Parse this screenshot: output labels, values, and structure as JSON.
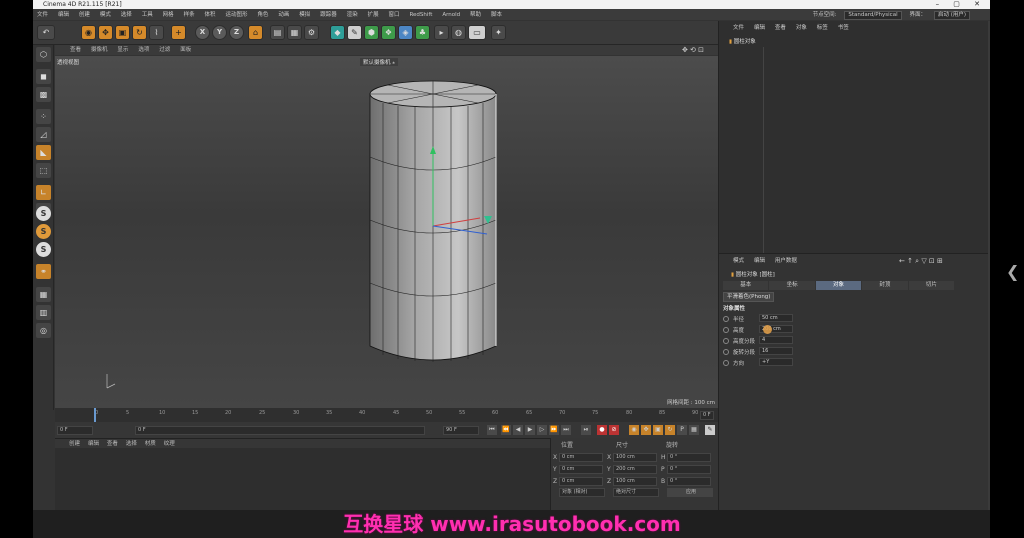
{
  "window": {
    "title": "Cinema 4D R21.115 [R21]",
    "controls": "– ▢ ✕"
  },
  "menu": {
    "items": [
      "文件",
      "编辑",
      "创建",
      "模式",
      "选择",
      "工具",
      "网格",
      "样条",
      "体积",
      "运动图形",
      "角色",
      "动画",
      "模拟",
      "跟踪器",
      "渲染",
      "扩展",
      "窗口",
      "RedShift",
      "Arnold",
      "帮助",
      "脚本"
    ],
    "right": {
      "interface_label": "界面：",
      "interface_value": "启动 (用户)",
      "layout_label": "节点空间:",
      "layout_value": "Standard/Physical"
    }
  },
  "toolbar": {
    "undo": "↶",
    "axes": [
      "X",
      "Y",
      "Z"
    ]
  },
  "viewport": {
    "menu": [
      "查看",
      "摄像机",
      "显示",
      "选项",
      "过滤",
      "面板"
    ],
    "label": "透视视图",
    "camera": "默认摄像机 ⁎",
    "grid": "网格间距 : 100 cm"
  },
  "timeline": {
    "ticks": [
      "0",
      "5",
      "10",
      "15",
      "20",
      "25",
      "30",
      "35",
      "40",
      "45",
      "50",
      "55",
      "60",
      "65",
      "70",
      "75",
      "80",
      "85",
      "90"
    ],
    "end": "0 F",
    "start_field": "0 F",
    "range_start": "0 F",
    "range_end": "90 F",
    "range_end2": "90 F"
  },
  "material": {
    "menu": [
      "创建",
      "编辑",
      "查看",
      "选择",
      "材质",
      "纹理"
    ]
  },
  "coords": {
    "headers": [
      "位置",
      "尺寸",
      "旋转"
    ],
    "rows": [
      {
        "axis": "X",
        "pos": "0 cm",
        "size_axis": "X",
        "size": "100 cm",
        "rot_axis": "H",
        "rot": "0 °"
      },
      {
        "axis": "Y",
        "pos": "0 cm",
        "size_axis": "Y",
        "size": "200 cm",
        "rot_axis": "P",
        "rot": "0 °"
      },
      {
        "axis": "Z",
        "pos": "0 cm",
        "size_axis": "Z",
        "size": "100 cm",
        "rot_axis": "B",
        "rot": "0 °"
      }
    ],
    "mode": "对象 (相对)",
    "size_mode": "绝对尺寸",
    "apply": "应用"
  },
  "objects": {
    "tabs": [
      "文件",
      "编辑",
      "查看",
      "对象",
      "标签",
      "书签"
    ],
    "item": "圆柱对象"
  },
  "attributes": {
    "tabs": [
      "模式",
      "编辑",
      "用户数据"
    ],
    "title": "圆柱对象 [圆柱]",
    "subtabs": [
      "基本",
      "坐标",
      "对象",
      "封顶",
      "切片"
    ],
    "active_subtab": "对象",
    "coord_tab": "平滑着色(Phong)",
    "section": "对象属性",
    "params": [
      {
        "label": "半径",
        "value": "50 cm"
      },
      {
        "label": "高度",
        "value": "200 cm"
      },
      {
        "label": "高度分段",
        "value": "4"
      },
      {
        "label": "旋转分段",
        "value": "16"
      },
      {
        "label": "方向",
        "value": "+Y"
      }
    ]
  },
  "watermark": "互换星球 www.irasutobook.com",
  "nav": "❮"
}
